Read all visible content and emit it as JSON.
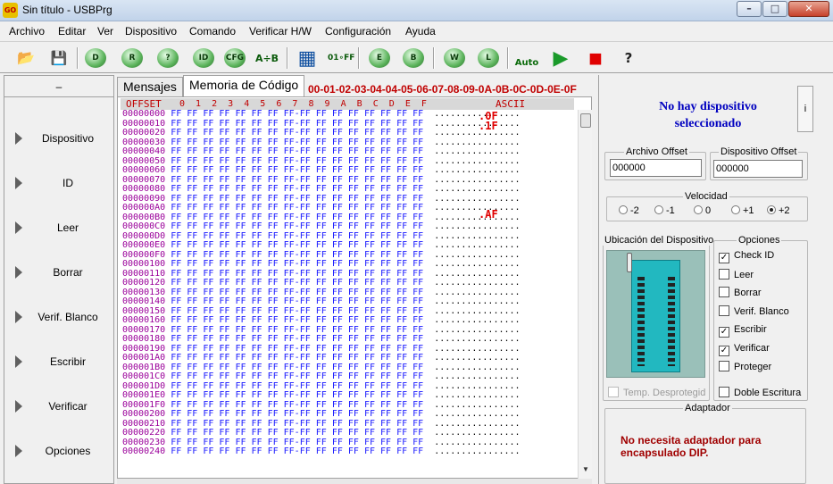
{
  "window": {
    "title": "Sin título - USBPrg",
    "app_icon": "GO",
    "min_label": "–",
    "max_label": "□",
    "close_label": "✕"
  },
  "menu": [
    "Archivo",
    "Editar",
    "Ver",
    "Dispositivo",
    "Comando",
    "Verificar H/W",
    "Configuración",
    "Ayuda"
  ],
  "toolbar": {
    "buttons": [
      {
        "icon": "open-folder-icon",
        "glyph": "📂"
      },
      {
        "icon": "save-disk-icon",
        "glyph": "💾"
      },
      {
        "icon": "read-d-icon",
        "glyph": "D"
      },
      {
        "icon": "read-r-icon",
        "glyph": "R"
      },
      {
        "icon": "blank-check-icon",
        "glyph": "?"
      },
      {
        "icon": "id-icon",
        "glyph": "ID"
      },
      {
        "icon": "cfg-icon",
        "glyph": "CFG"
      },
      {
        "icon": "compare-icon",
        "glyph": "A÷B"
      },
      {
        "icon": "hex-editor-icon",
        "glyph": "▦"
      },
      {
        "icon": "fill-icon",
        "glyph": "01∘FF"
      },
      {
        "icon": "erase-icon",
        "glyph": "E"
      },
      {
        "icon": "blank-b-icon",
        "glyph": "B"
      },
      {
        "icon": "write-w-icon",
        "glyph": "W"
      },
      {
        "icon": "lock-l-icon",
        "glyph": "L"
      },
      {
        "icon": "auto-icon",
        "glyph": "Auto"
      },
      {
        "icon": "play-icon",
        "glyph": "▶"
      },
      {
        "icon": "stop-icon",
        "glyph": "■"
      },
      {
        "icon": "help-icon",
        "glyph": "?"
      }
    ]
  },
  "left_panel": {
    "header": "–",
    "items": [
      "Dispositivo",
      "ID",
      "Leer",
      "Borrar",
      "Verif. Blanco",
      "Escribir",
      "Verificar",
      "Opciones"
    ]
  },
  "tabs": [
    {
      "label": "Mensajes"
    },
    {
      "label": "Memoria de Código"
    }
  ],
  "hex_header_columns": "00-01-02-03-04-04-05-06-07-08-09-0A-0B-0C-0D-0E-0F",
  "hex_view": {
    "header_offset": "OFFSET",
    "header_cols": "0  1  2  3  4  5  6  7  8  9  A  B  C  D  E  F",
    "header_ascii": "ASCII",
    "row_bytes": "FF FF FF FF FF FF FF FF-FF FF FF FF FF FF FF FF",
    "row_ascii": "................",
    "rows": [
      "00000000",
      "00000010",
      "00000020",
      "00000030",
      "00000040",
      "00000050",
      "00000060",
      "00000070",
      "00000080",
      "00000090",
      "000000A0",
      "000000B0",
      "000000C0",
      "000000D0",
      "000000E0",
      "000000F0",
      "00000100",
      "00000110",
      "00000120",
      "00000130",
      "00000140",
      "00000150",
      "00000160",
      "00000170",
      "00000180",
      "00000190",
      "000001A0",
      "000001B0",
      "000001C0",
      "000001D0",
      "000001E0",
      "000001F0",
      "00000200",
      "00000210",
      "00000220",
      "00000230",
      "00000240"
    ],
    "marks": [
      ".0F",
      ".1F",
      ".AF"
    ]
  },
  "right_panel": {
    "no_device": "No hay dispositivo seleccionado",
    "info_button": "i",
    "archivo_offset_label": "Archivo Offset",
    "archivo_offset_value": "000000",
    "dispositivo_offset_label": "Dispositivo Offset",
    "dispositivo_offset_value": "000000",
    "velocidad_label": "Velocidad",
    "velocidad_options": [
      "-2",
      "-1",
      "0",
      "+1",
      "+2"
    ],
    "velocidad_selected": "+2",
    "ubicacion_label": "Ubicación del Dispositivo",
    "opciones_label": "Opciones",
    "opciones": [
      {
        "label": "Check ID",
        "checked": true
      },
      {
        "label": "Leer",
        "checked": false
      },
      {
        "label": "Borrar",
        "checked": false
      },
      {
        "label": "Verif. Blanco",
        "checked": false
      },
      {
        "label": "Escribir",
        "checked": true
      },
      {
        "label": "Verificar",
        "checked": true
      },
      {
        "label": "Proteger",
        "checked": false
      }
    ],
    "temp_desprotegido": "Temp. Desprotegid",
    "doble_escritura": "Doble Escritura",
    "adaptador_label": "Adaptador",
    "adaptador_msg": "No necesita adaptador para encapsulado DIP."
  }
}
